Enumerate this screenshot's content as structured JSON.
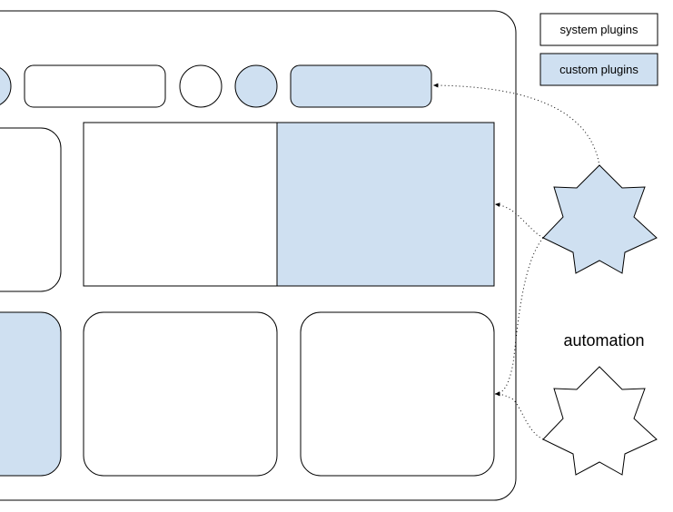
{
  "colors": {
    "custom_fill": "#cfe0f1",
    "system_fill": "#ffffff",
    "stroke": "#000000"
  },
  "legend": {
    "system": "system plugins",
    "custom": "custom plugins"
  },
  "labels": {
    "automation": "automation"
  },
  "icons": {
    "custom_automation": "seven-point-star-blue",
    "system_automation": "seven-point-star-white"
  }
}
